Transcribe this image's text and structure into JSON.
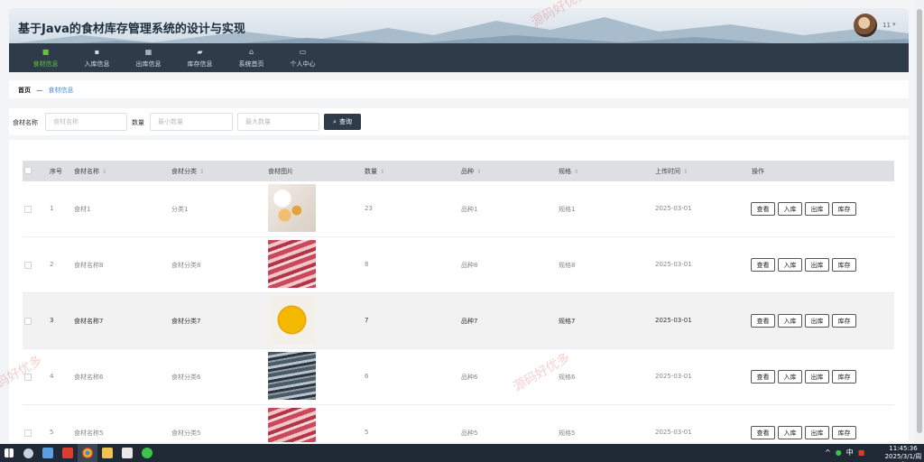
{
  "header": {
    "title": "基于Java的食材库存管理系统的设计与实现",
    "user": "11",
    "nav": [
      {
        "label": "食材信息",
        "icon": "grid-icon",
        "glyph": "■"
      },
      {
        "label": "入库信息",
        "icon": "clipboard-icon",
        "glyph": "▪"
      },
      {
        "label": "出库信息",
        "icon": "grid-icon",
        "glyph": "▦"
      },
      {
        "label": "库存信息",
        "icon": "folder-icon",
        "glyph": "▰"
      },
      {
        "label": "系统首页",
        "icon": "home-icon",
        "glyph": "⌂"
      },
      {
        "label": "个人中心",
        "icon": "user-card-icon",
        "glyph": "▭"
      }
    ],
    "active_color": "#67c23a"
  },
  "breadcrumb": {
    "home": "首页",
    "separator": "—",
    "current": "食材信息"
  },
  "search": {
    "name_label": "食材名称",
    "name_placeholder": "食材名称",
    "qty_label": "数量",
    "min_placeholder": "最小数量",
    "max_placeholder": "最大数量",
    "button": "查询"
  },
  "table": {
    "headers": [
      "序号",
      "食材名称",
      "食材分类",
      "食材图片",
      "数量",
      "品种",
      "规格",
      "上传时间",
      "操作"
    ],
    "rows": [
      {
        "no": "1",
        "name": "食材1",
        "category": "分类1",
        "qty": "23",
        "variety": "品种1",
        "spec": "规格1",
        "time": "2025-03-01"
      },
      {
        "no": "2",
        "name": "食材名称8",
        "category": "食材分类8",
        "qty": "8",
        "variety": "品种8",
        "spec": "规格8",
        "time": "2025-03-01"
      },
      {
        "no": "3",
        "name": "食材名称7",
        "category": "食材分类7",
        "qty": "7",
        "variety": "品种7",
        "spec": "规格7",
        "time": "2025-03-01"
      },
      {
        "no": "4",
        "name": "食材名称6",
        "category": "食材分类6",
        "qty": "6",
        "variety": "品种6",
        "spec": "规格6",
        "time": "2025-03-01"
      },
      {
        "no": "5",
        "name": "食材名称5",
        "category": "食材分类5",
        "qty": "5",
        "variety": "品种5",
        "spec": "规格5",
        "time": "2025-03-01"
      }
    ],
    "actions": [
      "查看",
      "入库",
      "出库",
      "库存"
    ]
  },
  "watermark": "源码好优多",
  "taskbar": {
    "ime": "中",
    "time": "11:45:36",
    "date": "2025/3/1/周六"
  }
}
